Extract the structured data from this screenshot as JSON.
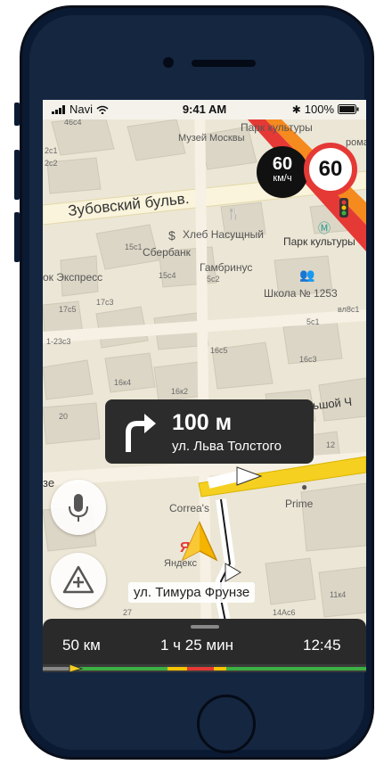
{
  "status": {
    "carrier": "Navi",
    "time": "9:41 AM",
    "battery": "100%"
  },
  "map_labels": {
    "muzei": "Музей Москвы",
    "park_top": "Парк культуры",
    "zubovsky": "Зубовский бульв.",
    "khleb": "Хлеб Насущный",
    "sberbank": "Сбербанк",
    "park_metro": "Парк культуры",
    "gambrinus": "Гамбринус",
    "school": "Школа № 1253",
    "ok": "ок Экспресс",
    "bolshoy": "ьшой Ч",
    "coreas": "Correa's",
    "prime": "Prime",
    "yandex": "Яндекс",
    "ze": "зе",
    "roma": "рома",
    "building_numbers": [
      "46с4",
      "2с1",
      "2с2",
      "15с1",
      "15с4",
      "5с2",
      "17с5",
      "17с3",
      "1-23с3",
      "16с5",
      "16с3",
      "16к4",
      "16к2",
      "5с1",
      "вл8с1",
      "20",
      "12",
      "11к4",
      "14Ас6",
      "27"
    ]
  },
  "speed": {
    "current": "60",
    "unit": "км/ч",
    "limit": "60"
  },
  "maneuver": {
    "distance": "100 м",
    "street": "ул. Льва Толстого"
  },
  "current_street": "ул. Тимура Фрунзе",
  "trip": {
    "distance": "50 км",
    "duration": "1 ч 25 мин",
    "arrival": "12:45"
  },
  "icons": [
    "signal-icon",
    "wifi-icon",
    "bluetooth-icon",
    "battery-icon",
    "turn-right-icon",
    "microphone-icon",
    "add-road-event-icon",
    "navigation-arrow-icon",
    "traffic-light-icon",
    "metro-icon"
  ],
  "colors": {
    "route": "#f5d020",
    "speed_limit_ring": "#e53935",
    "traffic_red": "#e53935"
  }
}
